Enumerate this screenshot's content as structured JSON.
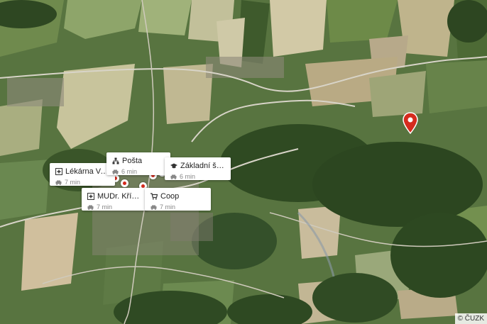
{
  "map": {
    "attribution": "© ČUZK",
    "pois": [
      {
        "name": "Lékárna Vacov",
        "time": "7 min",
        "icon": "pharmacy-icon"
      },
      {
        "name": "Pošta",
        "time": "6 min",
        "icon": "post-office-icon"
      },
      {
        "name": "Základní škola Va...",
        "time": "6 min",
        "icon": "school-icon"
      },
      {
        "name": "MUDr. Křížová M...",
        "time": "7 min",
        "icon": "doctor-icon"
      },
      {
        "name": "Coop",
        "time": "7 min",
        "icon": "shopping-cart-icon"
      }
    ],
    "travel_mode_icon": "car-icon",
    "location_marker_color": "#d52b1e"
  }
}
